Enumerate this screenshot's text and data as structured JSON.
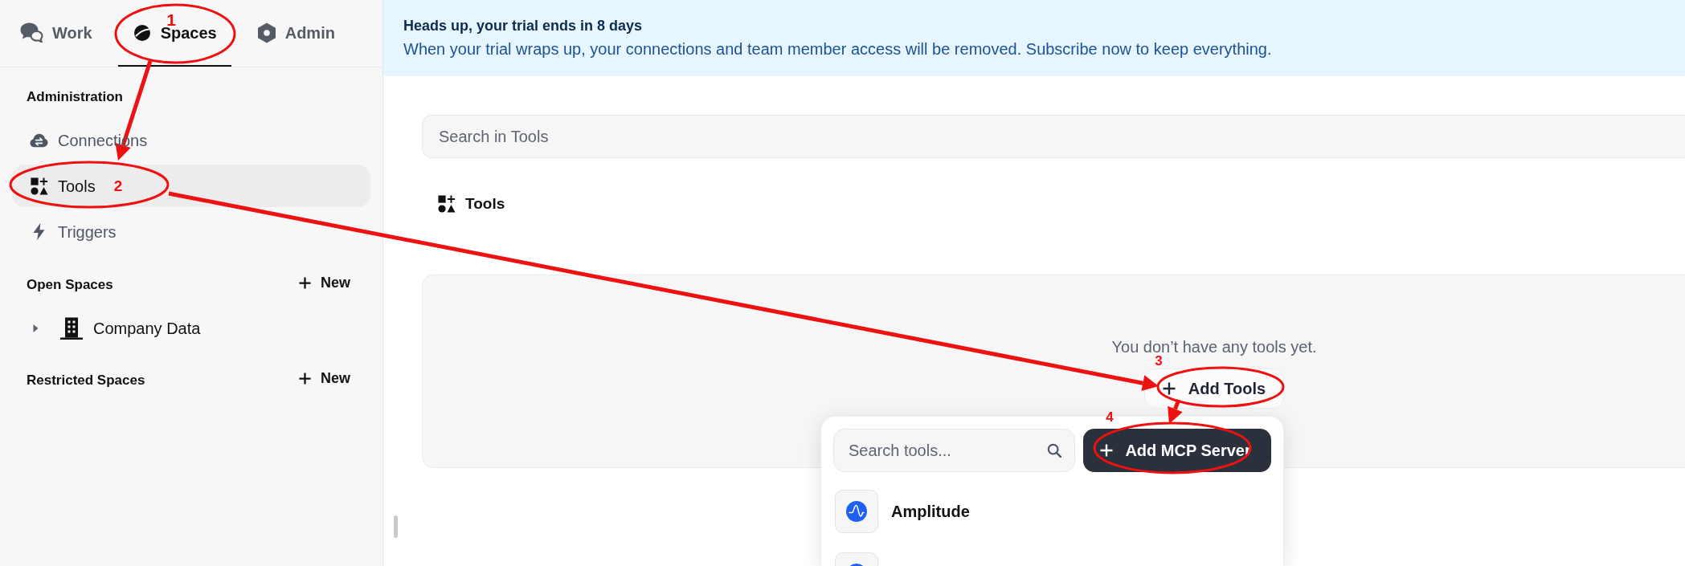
{
  "sidebar": {
    "tabs": [
      {
        "label": "Work",
        "selected": false
      },
      {
        "label": "Spaces",
        "selected": true
      },
      {
        "label": "Admin",
        "selected": false
      }
    ],
    "sections": [
      {
        "kind": "nav",
        "title": "Administration",
        "items": [
          {
            "label": "Connections",
            "selected": false
          },
          {
            "label": "Tools",
            "selected": true
          },
          {
            "label": "Triggers",
            "selected": false
          }
        ]
      },
      {
        "kind": "spaces",
        "title": "Open Spaces",
        "action": "New",
        "spaces": [
          {
            "label": "Company Data",
            "expanded": false
          }
        ]
      },
      {
        "kind": "spaces",
        "title": "Restricted Spaces",
        "action": "New"
      }
    ]
  },
  "banner": {
    "title": "Heads up, your trial ends in 8 days",
    "message": "When your trial wraps up, your connections and team member access will be removed. Subscribe now to keep everything."
  },
  "search": {
    "placeholder": "Search in Tools"
  },
  "section_header": {
    "title": "Tools"
  },
  "empty_state": {
    "message": "You don’t have any tools yet.",
    "button": "Add Tools"
  },
  "tool_picker": {
    "search_placeholder": "Search tools...",
    "button": "Add MCP Server",
    "items": [
      {
        "name": "Amplitude"
      }
    ],
    "more_below": true
  },
  "annotations": [
    {
      "number": "1"
    },
    {
      "number": "2"
    },
    {
      "number": "3"
    },
    {
      "number": "4"
    }
  ]
}
